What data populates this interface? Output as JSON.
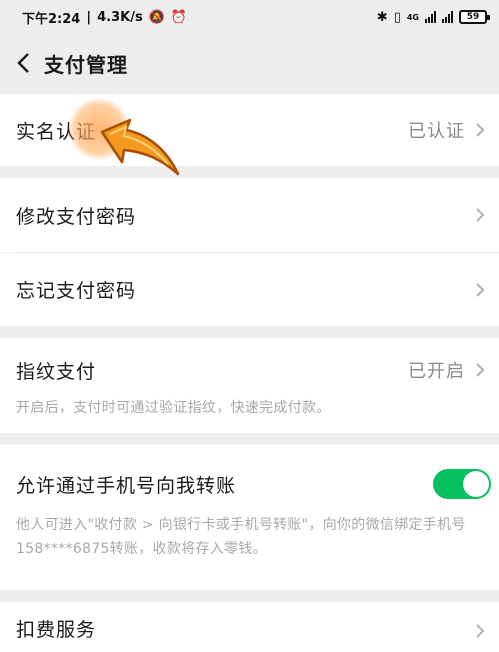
{
  "status_bar": {
    "time": "下午2:24",
    "speed": "4.3K/s",
    "network_tag": "4G",
    "battery": "59"
  },
  "nav": {
    "title": "支付管理"
  },
  "rows": {
    "real_name": {
      "label": "实名认证",
      "value": "已认证"
    },
    "modify_password": {
      "label": "修改支付密码"
    },
    "forgot_password": {
      "label": "忘记支付密码"
    },
    "fingerprint": {
      "label": "指纹支付",
      "value": "已开启",
      "description": "开启后，支付时可通过验证指纹，快速完成付款。"
    },
    "phone_transfer": {
      "label": "允许通过手机号向我转账",
      "enabled": true,
      "description": "他人可进入\"收付款 > 向银行卡或手机号转账\"，向你的微信绑定手机号158****6875转账，收款将存入零钱。"
    },
    "deduction": {
      "label": "扣费服务"
    }
  },
  "colors": {
    "accent_green": "#07c160",
    "highlight_orange": "#f08a24"
  }
}
